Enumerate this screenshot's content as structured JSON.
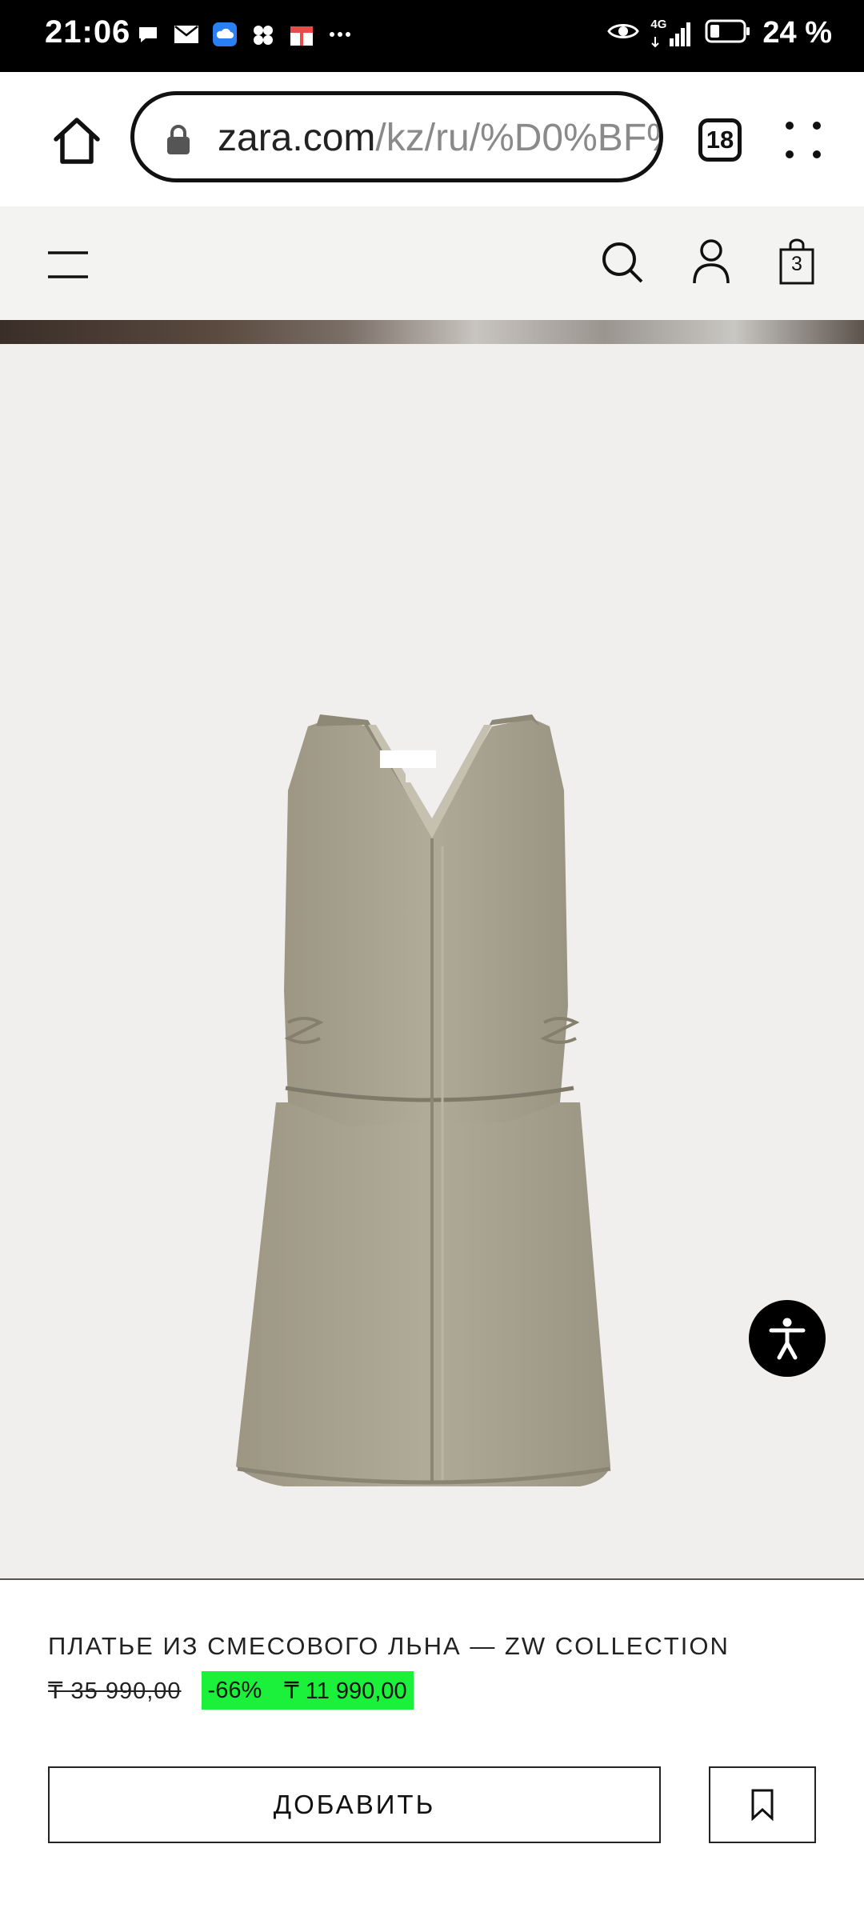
{
  "status_bar": {
    "time": "21:06",
    "network": "4G",
    "battery_percent": "24 %"
  },
  "browser": {
    "url_domain": "zara.com",
    "url_path": "/kz/ru/%D0%BF%",
    "tab_count": "18"
  },
  "header": {
    "cart_count": "3"
  },
  "product": {
    "title": "ПЛАТЬЕ ИЗ СМЕСОВОГО ЛЬНА — ZW COLLECTION",
    "old_price": "₸ 35 990,00",
    "discount": "-66%",
    "new_price": "₸ 11 990,00",
    "add_button_label": "ДОБАВИТЬ"
  },
  "colors": {
    "sale_highlight": "#1bf03a",
    "image_background": "#f0efed",
    "dress": "#a8a291"
  }
}
